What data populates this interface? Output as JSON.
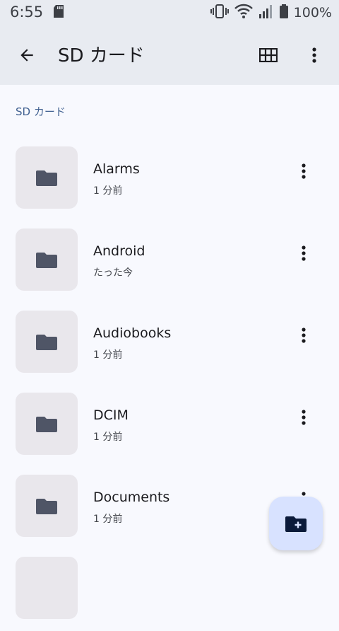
{
  "status_bar": {
    "time": "6:55",
    "battery": "100%"
  },
  "app_bar": {
    "title": "SD カード"
  },
  "breadcrumb": "SD カード",
  "folders": [
    {
      "name": "Alarms",
      "modified": "1 分前"
    },
    {
      "name": "Android",
      "modified": "たった今"
    },
    {
      "name": "Audiobooks",
      "modified": "1 分前"
    },
    {
      "name": "DCIM",
      "modified": "1 分前"
    },
    {
      "name": "Documents",
      "modified": "1 分前"
    }
  ],
  "icons": {
    "back": "arrow-back-icon",
    "grid": "grid-view-icon",
    "more": "more-vert-icon",
    "folder": "folder-icon",
    "new_folder": "create-new-folder-icon"
  },
  "colors": {
    "app_bar_bg": "#e8ebf1",
    "page_bg": "#f8f9fe",
    "fab_bg": "#d8e2ff",
    "folder_icon": "#4f5566",
    "breadcrumb": "#3f5f90"
  }
}
